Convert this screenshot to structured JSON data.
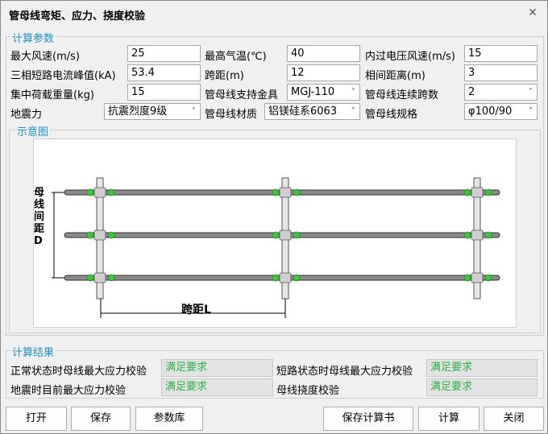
{
  "window": {
    "title": "管母线弯矩、应力、挠度校验"
  },
  "params": {
    "group_title": "计算参数",
    "max_wind_label": "最大风速(m/s)",
    "max_wind_value": "25",
    "max_temp_label": "最高气温(℃)",
    "max_temp_value": "40",
    "overvolt_wind_label": "内过电压风速(m/s)",
    "overvolt_wind_value": "15",
    "short_circuit_label": "三相短路电流峰值(kA)",
    "short_circuit_value": "53.4",
    "span_label": "跨距(m)",
    "span_value": "12",
    "phase_dist_label": "相间距离(m)",
    "phase_dist_value": "3",
    "load_label": "集中荷载重量(kg)",
    "load_value": "15",
    "fitting_label": "管母线支持金具",
    "fitting_value": "MGJ-110",
    "cont_span_label": "管母线连续跨数",
    "cont_span_value": "2",
    "seismic_label": "地震力",
    "seismic_value": "抗震烈度9级",
    "material_label": "管母线材质",
    "material_value": "铝镁硅系6063",
    "spec_label": "管母线规格",
    "spec_value": "φ100/90"
  },
  "diagram": {
    "group_title": "示意图",
    "phase_label": "母线间距D",
    "span_label": "跨距L"
  },
  "results": {
    "group_title": "计算结果",
    "normal_label": "正常状态时母线最大应力校验",
    "normal_value": "满足要求",
    "short_label": "短路状态时母线最大应力校验",
    "short_value": "满足要求",
    "seismic_label": "地震时目前最大应力校验",
    "seismic_value": "满足要求",
    "deflection_label": "母线挠度校验",
    "deflection_value": "满足要求"
  },
  "buttons": {
    "open": "打开",
    "save": "保存",
    "params_lib": "参数库",
    "save_calc": "保存计算书",
    "calc": "计算",
    "close": "关闭"
  },
  "colors": {
    "accent": "#1e90c8",
    "ok": "#2fb14a",
    "green_fitting": "#3ec43e"
  }
}
